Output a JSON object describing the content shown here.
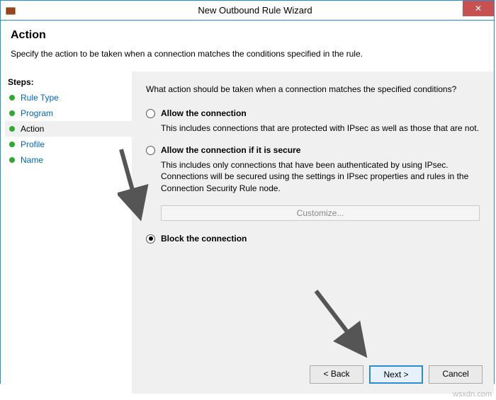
{
  "window": {
    "title": "New Outbound Rule Wizard"
  },
  "header": {
    "title": "Action",
    "subtitle": "Specify the action to be taken when a connection matches the conditions specified in the rule."
  },
  "sidebar": {
    "title": "Steps:",
    "items": [
      {
        "label": "Rule Type"
      },
      {
        "label": "Program"
      },
      {
        "label": "Action"
      },
      {
        "label": "Profile"
      },
      {
        "label": "Name"
      }
    ]
  },
  "main": {
    "question": "What action should be taken when a connection matches the specified conditions?",
    "options": [
      {
        "label": "Allow the connection",
        "desc": "This includes connections that are protected with IPsec as well as those that are not.",
        "checked": false
      },
      {
        "label": "Allow the connection if it is secure",
        "desc": "This includes only connections that have been authenticated by using IPsec. Connections will be secured using the settings in IPsec properties and rules in the Connection Security Rule node.",
        "checked": false
      },
      {
        "label": "Block the connection",
        "desc": "",
        "checked": true
      }
    ],
    "customize_label": "Customize..."
  },
  "buttons": {
    "back": "< Back",
    "next": "Next >",
    "cancel": "Cancel"
  },
  "watermark": "wsxdn.com"
}
